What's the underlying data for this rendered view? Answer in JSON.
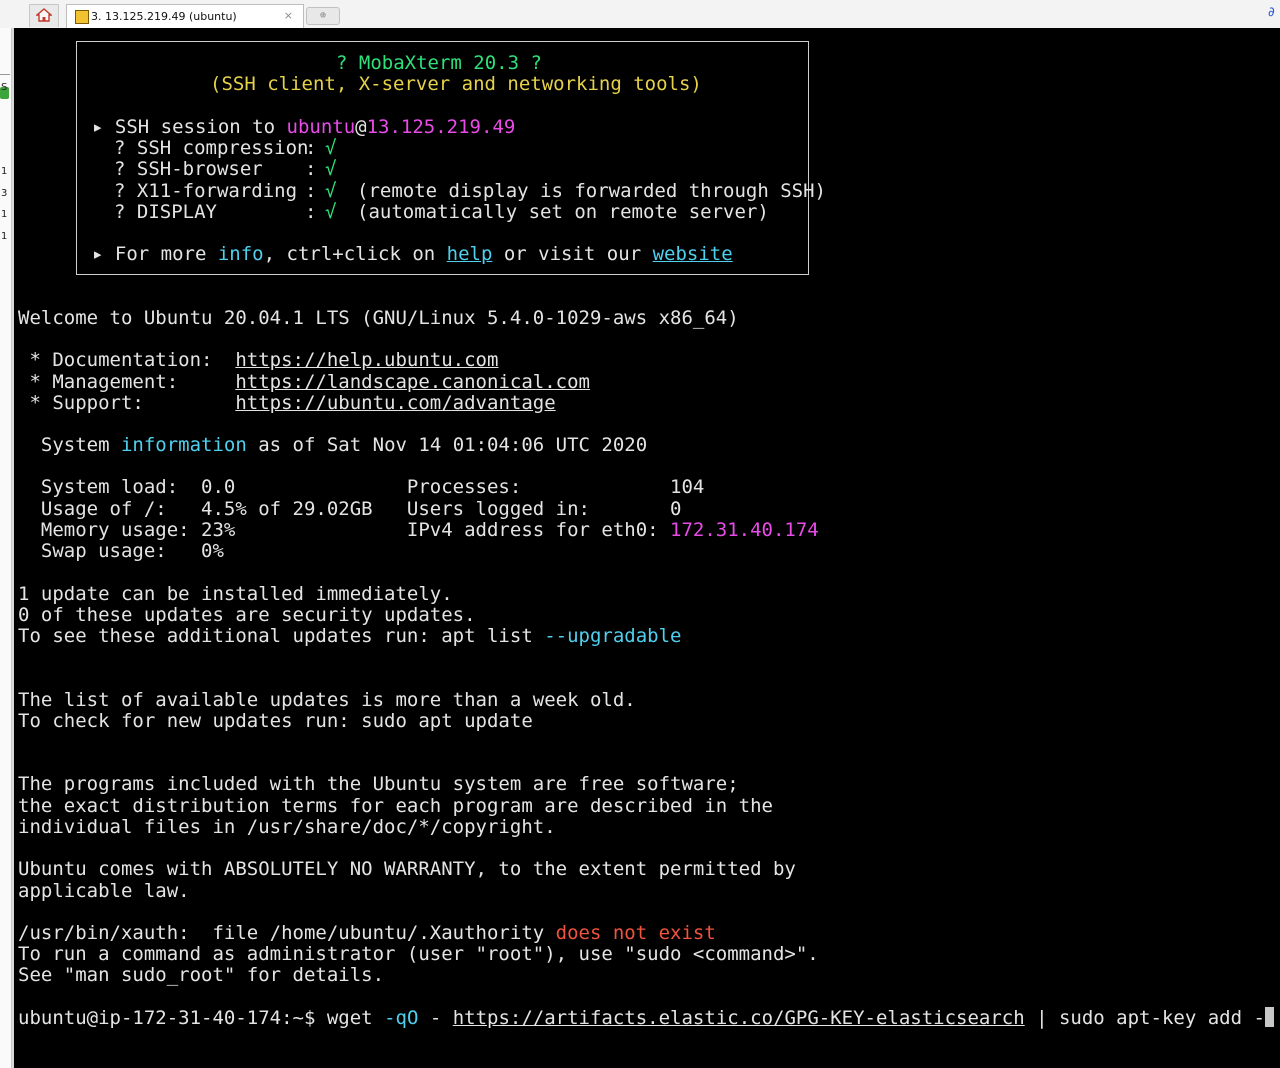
{
  "window": {
    "tab_label": "3. 13.125.219.49 (ubuntu)",
    "tab_close": "×",
    "new_tab": "⊕",
    "right_glyph": "∂"
  },
  "sidebar": {
    "letters": [
      "S",
      "1",
      "3",
      "1",
      "1"
    ]
  },
  "banner": {
    "title": "? MobaXterm 20.3 ?",
    "subtitle": "(SSH client, X-server and networking tools)",
    "session_bullet": "▸",
    "session_prefix": "SSH session to ",
    "session_user": "ubuntu",
    "session_at": "@",
    "session_host": "13.125.219.49",
    "rows": [
      {
        "q": "? ",
        "label": "SSH compression",
        "sep": ":",
        "check": "√",
        "note": ""
      },
      {
        "q": "? ",
        "label": "SSH-browser",
        "sep": ":",
        "check": "√",
        "note": ""
      },
      {
        "q": "? ",
        "label": "X11-forwarding",
        "sep": ":",
        "check": "√",
        "note": "(remote display is forwarded through SSH)"
      },
      {
        "q": "? ",
        "label": "DISPLAY",
        "sep": ":",
        "check": "√",
        "note": "(automatically set on remote server)"
      }
    ],
    "more_bullet": "▸",
    "more_prefix": "For more ",
    "more_info": "info",
    "more_mid": ", ctrl+click on ",
    "more_help": "help",
    "more_or": " or visit our ",
    "more_website": "website"
  },
  "motd": {
    "welcome": "Welcome to Ubuntu 20.04.1 LTS (GNU/Linux 5.4.0-1029-aws x86_64)",
    "links": [
      {
        "label": " * Documentation:  ",
        "url": "https://help.ubuntu.com"
      },
      {
        "label": " * Management:     ",
        "url": "https://landscape.canonical.com"
      },
      {
        "label": " * Support:        ",
        "url": "https://ubuntu.com/advantage"
      }
    ],
    "sysinfo_prefix": "  System ",
    "sysinfo_word": "information",
    "sysinfo_suffix": " as of Sat Nov 14 01:04:06 UTC 2020",
    "stats": [
      {
        "left": "  System load:  0.0               Processes:             104",
        "ip": ""
      },
      {
        "left": "  Usage of /:   4.5% of 29.02GB   Users logged in:       0",
        "ip": ""
      },
      {
        "left": "  Memory usage: 23%               IPv4 address for eth0: ",
        "ip": "172.31.40.174"
      },
      {
        "left": "  Swap usage:   0%",
        "ip": ""
      }
    ],
    "upd1": "1 update can be installed immediately.",
    "upd2": "0 of these updates are security updates.",
    "upd3_prefix": "To see these additional updates run: apt list ",
    "upd3_flag": "--upgradable",
    "old1": "The list of available updates is more than a week old.",
    "old2": "To check for new updates run: sudo apt update",
    "free1": "The programs included with the Ubuntu system are free software;",
    "free2": "the exact distribution terms for each program are described in the",
    "free3": "individual files in /usr/share/doc/*/copyright.",
    "warr1": "Ubuntu comes with ABSOLUTELY NO WARRANTY, to the extent permitted by",
    "warr2": "applicable law.",
    "xauth_prefix": "/usr/bin/xauth:  file /home/ubuntu/.Xauthority ",
    "xauth_err": "does not exist",
    "sudo1": "To run a command as administrator (user \"root\"), use \"sudo <command>\".",
    "sudo2": "See \"man sudo_root\" for details."
  },
  "prompt": {
    "ps1": "ubuntu@ip-172-31-40-174:~$ ",
    "cmd_start": "wget ",
    "flag": "-qO",
    "cmd_mid": " - ",
    "url": "https://artifacts.elastic.co/GPG-KEY-elasticsearch",
    "cmd_end": " | sudo apt-key add -"
  },
  "colors": {
    "background": "#000000",
    "text": "#e4e4e4",
    "green": "#2ee07a",
    "yellow": "#e6d24a",
    "magenta": "#e94be9",
    "cyan": "#4fd0ee",
    "red": "#f0533e"
  }
}
